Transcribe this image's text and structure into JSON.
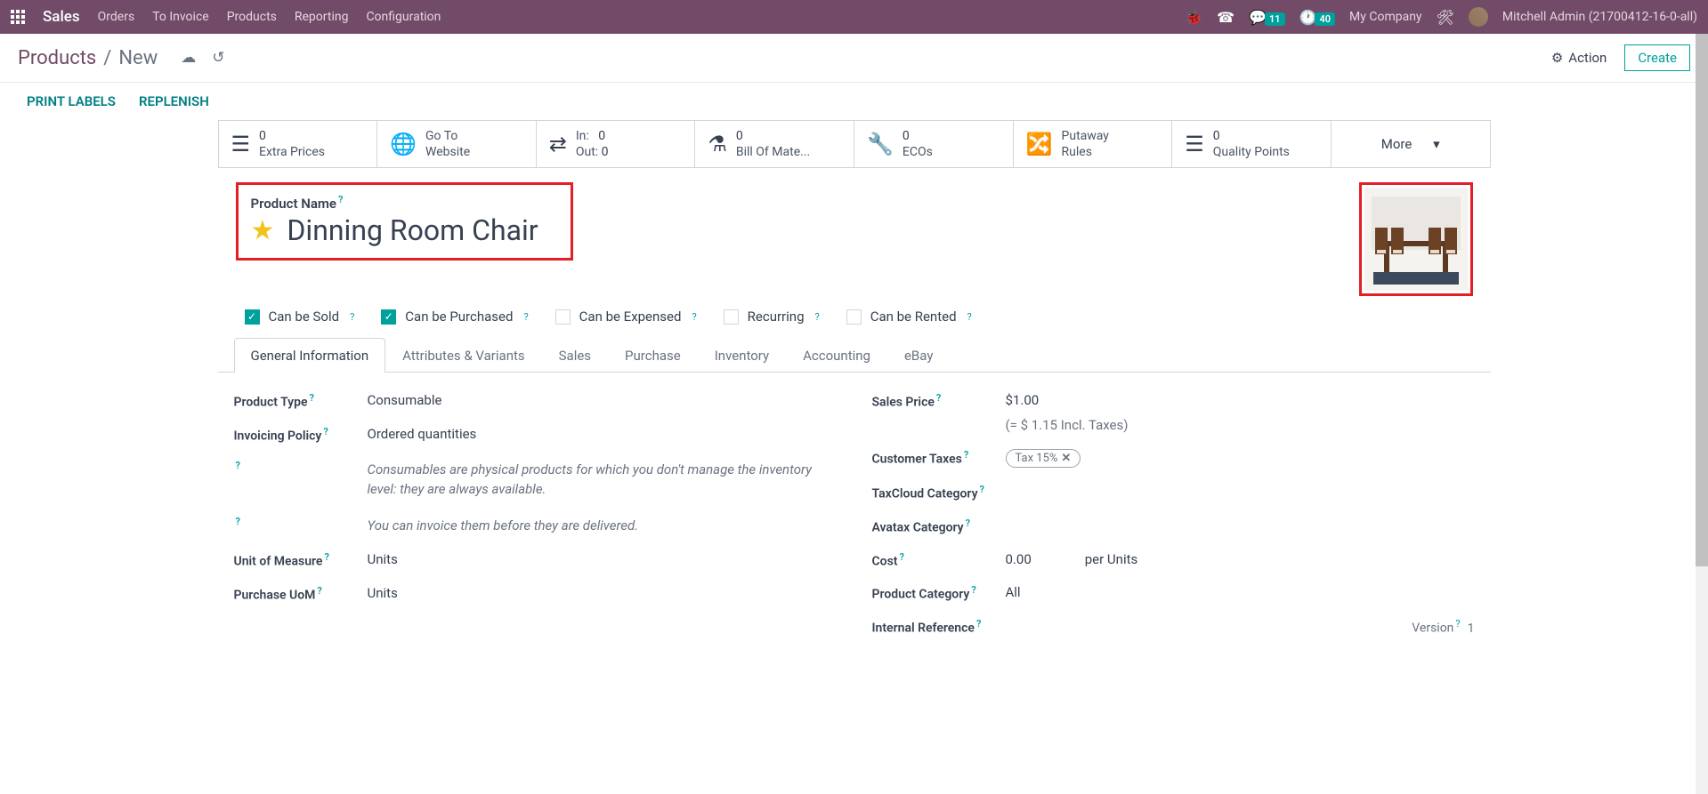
{
  "navbar": {
    "brand": "Sales",
    "menu": [
      "Orders",
      "To Invoice",
      "Products",
      "Reporting",
      "Configuration"
    ],
    "conversations_badge": "11",
    "activities_badge": "40",
    "company": "My Company",
    "user": "Mitchell Admin (21700412-16-0-all)"
  },
  "breadcrumb": {
    "link": "Products",
    "current": "New",
    "action_label": "Action",
    "create_label": "Create"
  },
  "sub_actions": {
    "print_labels": "PRINT LABELS",
    "replenish": "REPLENISH"
  },
  "stats": {
    "extra_prices": {
      "count": "0",
      "label": "Extra Prices"
    },
    "website": {
      "line1": "Go To",
      "line2": "Website"
    },
    "inout": {
      "in_label": "In:",
      "in_val": "0",
      "out_label": "Out:",
      "out_val": "0"
    },
    "bom": {
      "count": "0",
      "label": "Bill Of Mate..."
    },
    "ecos": {
      "count": "0",
      "label": "ECOs"
    },
    "putaway": {
      "line1": "Putaway",
      "line2": "Rules"
    },
    "quality": {
      "count": "0",
      "label": "Quality Points"
    },
    "more": "More"
  },
  "product": {
    "name_label": "Product Name",
    "name": "Dinning Room Chair"
  },
  "checkboxes": {
    "sold": "Can be Sold",
    "purchased": "Can be Purchased",
    "expensed": "Can be Expensed",
    "recurring": "Recurring",
    "rented": "Can be Rented"
  },
  "tabs": [
    "General Information",
    "Attributes & Variants",
    "Sales",
    "Purchase",
    "Inventory",
    "Accounting",
    "eBay"
  ],
  "general": {
    "product_type_label": "Product Type",
    "product_type": "Consumable",
    "invoicing_policy_label": "Invoicing Policy",
    "invoicing_policy": "Ordered quantities",
    "note1": "Consumables are physical products for which you don't manage the inventory level: they are always available.",
    "note2": "You can invoice them before they are delivered.",
    "uom_label": "Unit of Measure",
    "uom": "Units",
    "purchase_uom_label": "Purchase UoM",
    "purchase_uom": "Units",
    "sales_price_label": "Sales Price",
    "sales_price": "$1.00",
    "sales_price_incl": "(= $ 1.15 Incl. Taxes)",
    "customer_taxes_label": "Customer Taxes",
    "tax_tag": "Tax 15%",
    "taxcloud_label": "TaxCloud Category",
    "avatax_label": "Avatax Category",
    "cost_label": "Cost",
    "cost": "0.00",
    "cost_per": "per Units",
    "category_label": "Product Category",
    "category": "All",
    "internal_ref_label": "Internal Reference",
    "version_label": "Version",
    "version": "1"
  }
}
